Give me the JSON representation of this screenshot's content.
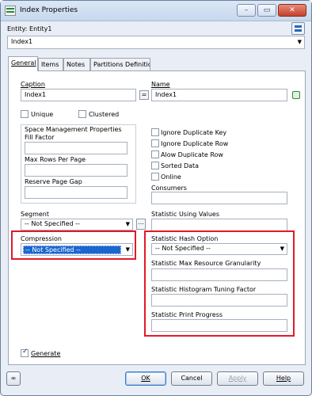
{
  "window": {
    "title": "Index Properties",
    "controls": {
      "minimize": "–",
      "maximize": "▭",
      "close": "✕"
    }
  },
  "entity": {
    "label": "Entity: Entity1",
    "selected": "Index1"
  },
  "tabs": [
    {
      "label": "General",
      "active": true
    },
    {
      "label": "Items"
    },
    {
      "label": "Notes"
    },
    {
      "label": "Partitions Definition"
    }
  ],
  "general": {
    "caption_label": "Caption",
    "caption_value": "Index1",
    "equals_button": "=",
    "name_label": "Name",
    "name_value": "Index1",
    "unique_label": "Unique",
    "unique_checked": false,
    "clustered_label": "Clustered",
    "clustered_checked": false,
    "space_group_title": "Space Management Properties",
    "fill_factor_label": "Fill Factor",
    "fill_factor_value": "",
    "max_rows_label": "Max Rows Per Page",
    "max_rows_value": "",
    "reserve_gap_label": "Reserve Page Gap",
    "reserve_gap_value": "",
    "checkboxes_right": [
      {
        "label": "Ignore Duplicate Key",
        "checked": false
      },
      {
        "label": "Ignore Duplicate Row",
        "checked": false
      },
      {
        "label": "Alow Duplicate Row",
        "checked": false
      },
      {
        "label": "Sorted Data",
        "checked": false
      },
      {
        "label": "Online",
        "checked": false
      }
    ],
    "consumers_label": "Consumers",
    "consumers_value": "",
    "segment_label": "Segment",
    "segment_value": "-- Not Specified --",
    "segment_more": "...",
    "statistic_using_values_label": "Statistic Using Values",
    "statistic_using_values_value": "",
    "compression_label": "Compression",
    "compression_value": "-- Not Specified --",
    "stat_hash_label": "Statistic Hash Option",
    "stat_hash_value": "-- Not Specified --",
    "stat_max_granularity_label": "Statistic Max Resource Granularity",
    "stat_max_granularity_value": "",
    "stat_hist_tuning_label": "Statistic Histogram Tuning Factor",
    "stat_hist_tuning_value": "",
    "stat_print_progress_label": "Statistic Print Progress",
    "stat_print_progress_value": "",
    "generate_label": "Generate",
    "generate_checked": true
  },
  "buttons": {
    "ok": "OK",
    "cancel": "Cancel",
    "apply": "Apply",
    "help": "Help"
  },
  "colors": {
    "highlight_border": "#e11a28",
    "selection": "#1b66d0"
  }
}
